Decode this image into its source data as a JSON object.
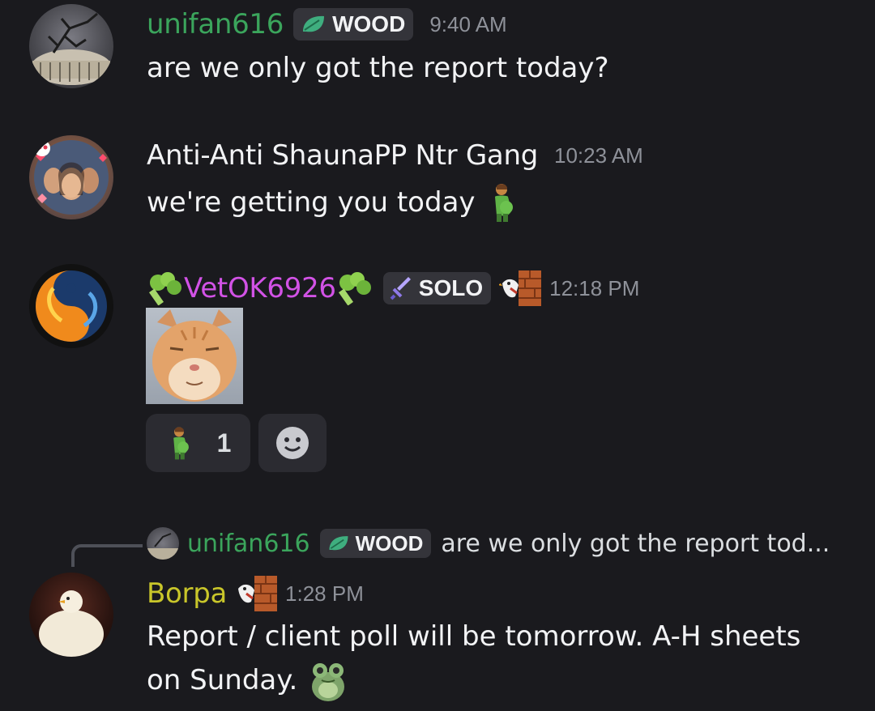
{
  "colors": {
    "background": "#1a1a1e",
    "username_green": "#3ba55c",
    "username_white": "#f2f3f5",
    "username_pink": "#d252e6",
    "username_yellow": "#c9c62a",
    "timestamp": "#8e9199",
    "tag_bg": "#34343a"
  },
  "messages": [
    {
      "author": "unifan616",
      "tag": "WOOD",
      "tag_icon": "leaf-icon",
      "time": "9:40 AM",
      "text": "are we only got the report today?"
    },
    {
      "author": "Anti-Anti ShaunaPP Ntr Gang",
      "time": "10:23 AM",
      "text": "we're getting you today",
      "text_emoji": "pregnant-man-emoji"
    },
    {
      "author_prefix_icon": "broccoli-icon",
      "author": "VetOK6926",
      "author_suffix_icon": "broccoli-icon",
      "tag": "SOLO",
      "tag_icon": "sword-icon",
      "extra_icon": "bird-brick-icon",
      "time": "12:18 PM",
      "image": "cat-image",
      "reactions": [
        {
          "emoji": "pregnant-man-emoji",
          "count": "1"
        },
        {
          "emoji": "add-reaction-icon",
          "count": ""
        }
      ]
    },
    {
      "reply_to": {
        "author": "unifan616",
        "tag": "WOOD",
        "text": "are we only got the report tod..."
      },
      "author": "Borpa",
      "extra_icon": "bird-brick-icon",
      "time": "1:28 PM",
      "text_line1": "Report / client poll will be tomorrow. A-H sheets",
      "text_line2": "on Sunday.",
      "text_emoji": "frog-emoji"
    }
  ]
}
